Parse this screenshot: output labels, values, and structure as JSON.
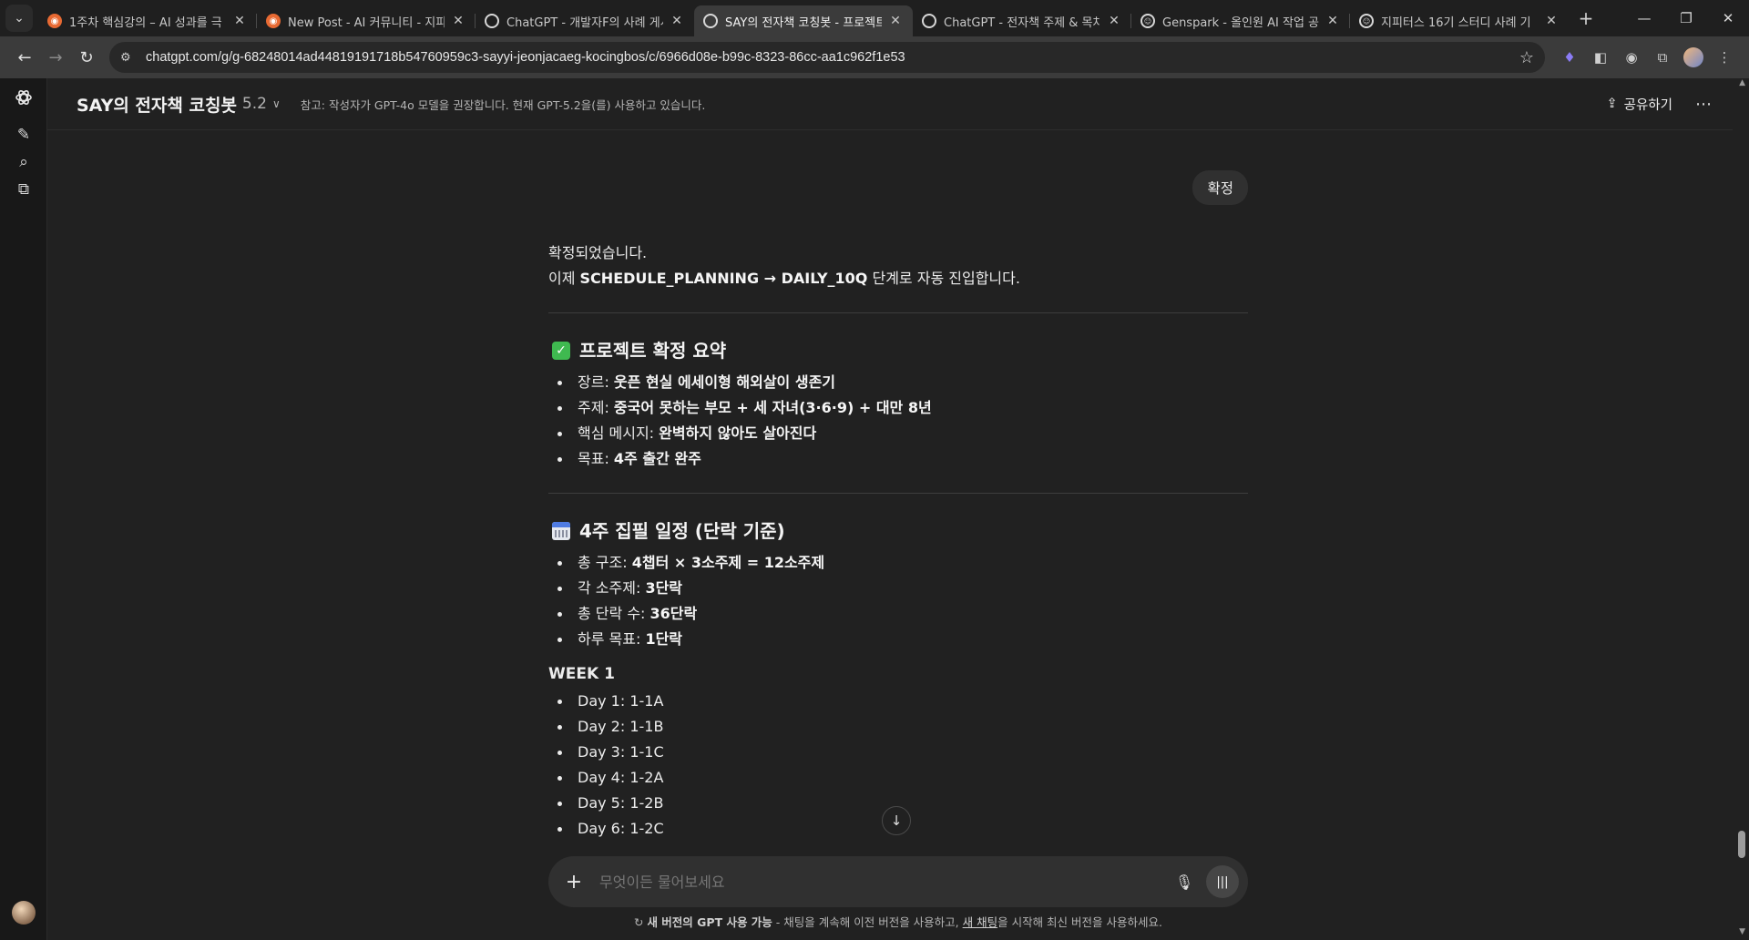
{
  "browser": {
    "tabs": [
      {
        "title": "1주차 핵심강의 – AI 성과를 극",
        "favicon": "orange",
        "active": false
      },
      {
        "title": "New Post - AI 커뮤니티 - 지피",
        "favicon": "orange",
        "active": false
      },
      {
        "title": "ChatGPT - 개발자F의 사례 게시",
        "favicon": "gpt",
        "active": false
      },
      {
        "title": "SAY의 전자책 코칭봇 - 프로젝트",
        "favicon": "gpt",
        "active": true
      },
      {
        "title": "ChatGPT - 전자책 주제 & 목차",
        "favicon": "gpt",
        "active": false
      },
      {
        "title": "Genspark - 올인원 AI 작업 공간",
        "favicon": "face",
        "active": false
      },
      {
        "title": "지피터스 16기 스터디 사례 기",
        "favicon": "face",
        "active": false
      }
    ],
    "url": "chatgpt.com/g/g-68248014ad44819191718b54760959c3-sayyi-jeonjacaeg-kocingbos/c/6966d08e-b99c-8323-86cc-aa1c962f1e53"
  },
  "header": {
    "gpt_name": "SAY의 전자책 코칭봇",
    "model_version": "5.2",
    "note": "참고: 작성자가 GPT-4o 모델을 권장합니다. 현재 GPT-5.2을(를) 사용하고 있습니다.",
    "share_label": "공유하기"
  },
  "conversation": {
    "user_message": "확정",
    "reply": {
      "line1": "확정되었습니다.",
      "line2_prefix": "이제 ",
      "line2_bold": "SCHEDULE_PLANNING → DAILY_10Q",
      "line2_suffix": " 단계로 자동 진입합니다.",
      "summary_title": "프로젝트 확정 요약",
      "summary_items": [
        {
          "label": "장르: ",
          "value": "웃픈 현실 에세이형 해외살이 생존기"
        },
        {
          "label": "주제: ",
          "value": "중국어 못하는 부모 + 세 자녀(3·6·9) + 대만 8년"
        },
        {
          "label": "핵심 메시지: ",
          "value": "완벽하지 않아도 살아진다"
        },
        {
          "label": "목표: ",
          "value": "4주 출간 완주"
        }
      ],
      "schedule_title": "4주 집필 일정 (단락 기준)",
      "schedule_items": [
        {
          "label": "총 구조: ",
          "value": "4챕터 × 3소주제 = 12소주제"
        },
        {
          "label": "각 소주제: ",
          "value": "3단락"
        },
        {
          "label": "총 단락 수: ",
          "value": "36단락"
        },
        {
          "label": "하루 목표: ",
          "value": "1단락"
        }
      ],
      "week_title": "WEEK 1",
      "week_days": [
        "Day 1: 1-1A",
        "Day 2: 1-1B",
        "Day 3: 1-1C",
        "Day 4: 1-2A",
        "Day 5: 1-2B",
        "Day 6: 1-2C"
      ]
    }
  },
  "composer": {
    "placeholder": "무엇이든 물어보세요"
  },
  "footer": {
    "bold": "새 버전의 GPT 사용 가능",
    "middle": " - 채팅을 계속해 이전 버전을 사용하고, ",
    "link": "새 채팅",
    "end": "을 시작해 최신 버전을 사용하세요."
  },
  "colors": {
    "background": "#212121",
    "rail": "#181818",
    "bubble": "#303030",
    "check_emoji": "#3fb950"
  }
}
